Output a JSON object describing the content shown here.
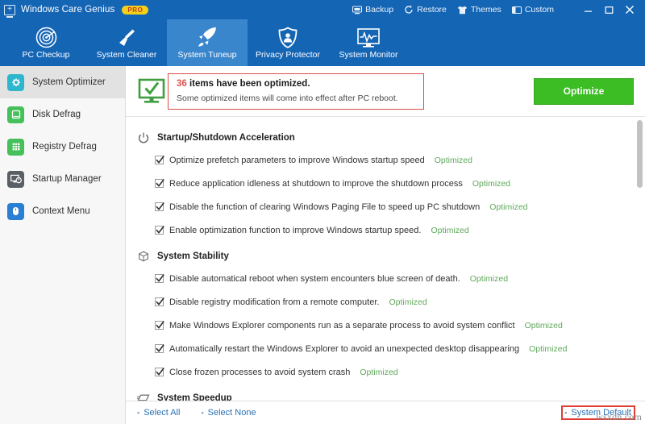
{
  "titlebar": {
    "app_name": "Windows Care Genius",
    "badge": "PRO",
    "actions": [
      {
        "label": "Backup",
        "icon": "backup-icon"
      },
      {
        "label": "Restore",
        "icon": "restore-icon"
      },
      {
        "label": "Themes",
        "icon": "themes-icon"
      },
      {
        "label": "Custom",
        "icon": "custom-icon"
      }
    ],
    "window_controls": [
      {
        "name": "minimize",
        "glyph": "minimize-icon"
      },
      {
        "name": "maximize",
        "glyph": "maximize-icon"
      },
      {
        "name": "close",
        "glyph": "close-icon"
      }
    ]
  },
  "nav": {
    "tabs": [
      {
        "label": "PC Checkup",
        "icon": "radar-icon",
        "active": false
      },
      {
        "label": "System Cleaner",
        "icon": "broom-icon",
        "active": false
      },
      {
        "label": "System Tuneup",
        "icon": "rocket-icon",
        "active": true
      },
      {
        "label": "Privacy Protector",
        "icon": "shield-icon",
        "active": false
      },
      {
        "label": "System Monitor",
        "icon": "monitor-pulse-icon",
        "active": false
      }
    ]
  },
  "sidebar": {
    "items": [
      {
        "label": "System Optimizer",
        "icon": "gear-wrench-icon",
        "color": "#2fb6cf",
        "active": true
      },
      {
        "label": "Disk Defrag",
        "icon": "hard-disk-icon",
        "color": "#45c койка"
      },
      {
        "label": "Registry Defrag",
        "icon": "registry-grid-icon",
        "color": "#45c05a"
      },
      {
        "label": "Startup Manager",
        "icon": "startup-monitor-icon",
        "color": "#5a5f66"
      },
      {
        "label": "Context Menu",
        "icon": "mouse-icon",
        "color": "#2a7fd4"
      }
    ]
  },
  "banner": {
    "icon": "monitor-check-icon",
    "count": "36",
    "headline_rest": " items have been optimized.",
    "subtext": "Some optimized items will come into effect after PC reboot.",
    "button_label": "Optimize"
  },
  "sections": [
    {
      "title": "Startup/Shutdown Acceleration",
      "icon": "power-icon",
      "items": [
        {
          "label": "Optimize prefetch parameters to improve Windows startup speed",
          "state": "Optimized",
          "checked": true
        },
        {
          "label": "Reduce application idleness at shutdown to improve the shutdown process",
          "state": "Optimized",
          "checked": true
        },
        {
          "label": "Disable the function of clearing Windows Paging File to speed up PC shutdown",
          "state": "Optimized",
          "checked": true
        },
        {
          "label": "Enable optimization function to improve Windows startup speed.",
          "state": "Optimized",
          "checked": true
        }
      ]
    },
    {
      "title": "System Stability",
      "icon": "cube-icon",
      "items": [
        {
          "label": "Disable automatical reboot when system encounters blue screen of death.",
          "state": "Optimized",
          "checked": true
        },
        {
          "label": "Disable registry modification from a remote computer.",
          "state": "Optimized",
          "checked": true
        },
        {
          "label": "Make Windows Explorer components run as a separate process to avoid system conflict",
          "state": "Optimized",
          "checked": true
        },
        {
          "label": "Automatically restart the Windows Explorer to avoid an unexpected desktop disappearing",
          "state": "Optimized",
          "checked": true
        },
        {
          "label": "Close frozen processes to avoid system crash",
          "state": "Optimized",
          "checked": true
        }
      ]
    },
    {
      "title": "System Speedup",
      "icon": "speed-icon",
      "items": []
    }
  ],
  "footer": {
    "select_all": "Select All",
    "select_none": "Select None",
    "system_default": "System Default"
  },
  "watermark": "wsxdn.com",
  "colors": {
    "titlebar_blue": "#1565b5",
    "active_tab_blue": "#3a86cd",
    "optimize_green": "#3bbd23",
    "state_green": "#5fa85a",
    "annotation_red": "#e03c31",
    "count_red": "#d9534f"
  }
}
